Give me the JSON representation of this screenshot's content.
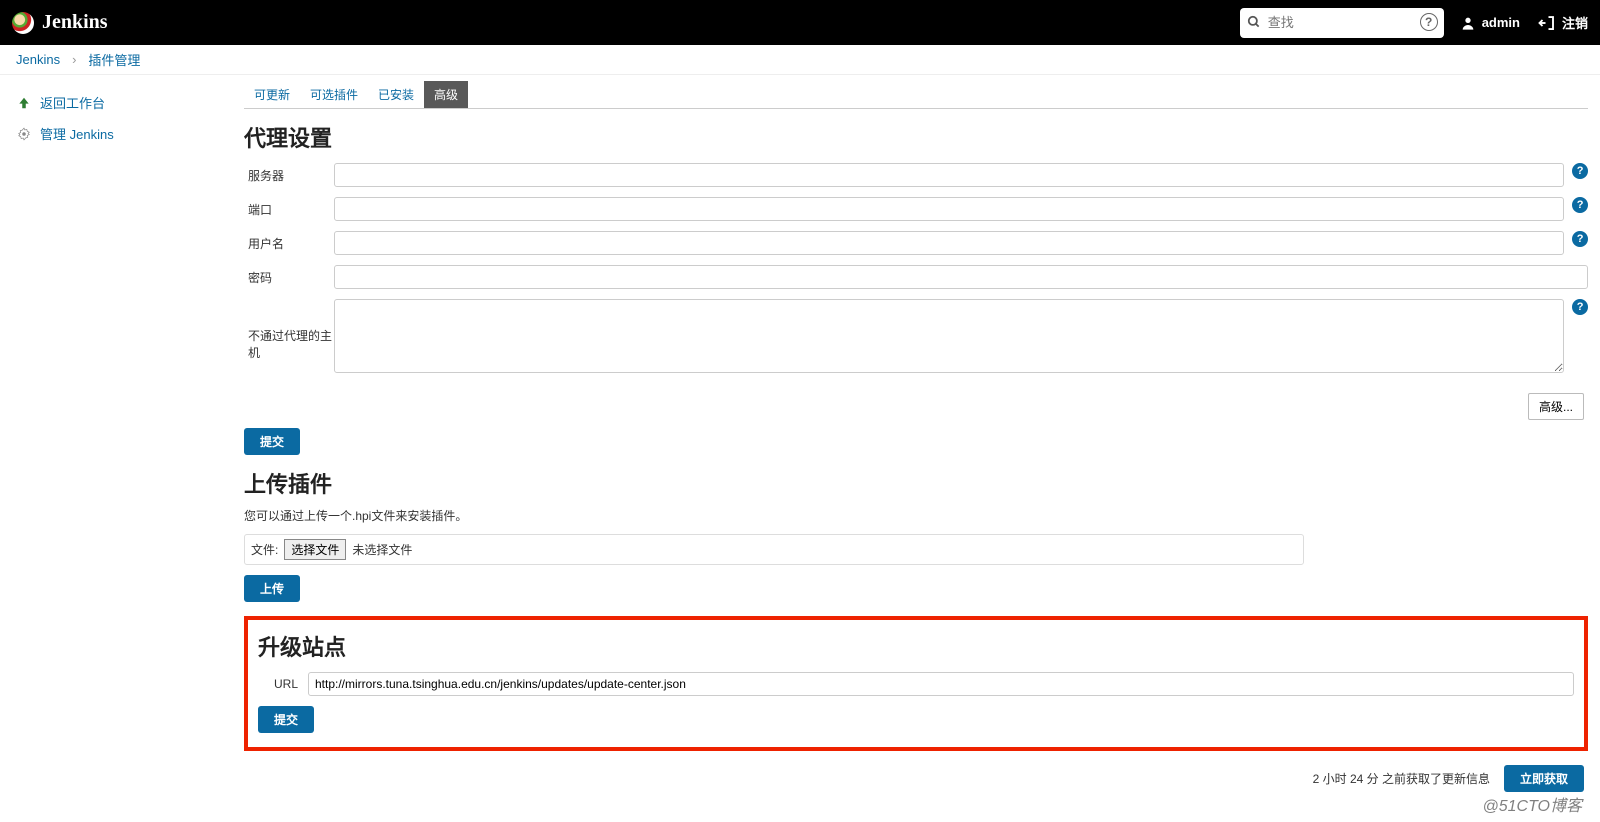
{
  "header": {
    "app_name": "Jenkins",
    "search_placeholder": "查找",
    "user_label": "admin",
    "logout_label": "注销"
  },
  "breadcrumb": {
    "root": "Jenkins",
    "page": "插件管理"
  },
  "sidebar": {
    "items": [
      {
        "label": "返回工作台"
      },
      {
        "label": "管理 Jenkins"
      }
    ]
  },
  "tabs": {
    "items": [
      {
        "label": "可更新"
      },
      {
        "label": "可选插件"
      },
      {
        "label": "已安装"
      },
      {
        "label": "高级",
        "active": true
      }
    ]
  },
  "proxy": {
    "title": "代理设置",
    "server_label": "服务器",
    "server_value": "",
    "port_label": "端口",
    "port_value": "",
    "user_label": "用户名",
    "user_value": "",
    "password_label": "密码",
    "password_value": "",
    "noproxy_label": "不通过代理的主机",
    "noproxy_value": "",
    "advanced_button": "高级...",
    "submit": "提交"
  },
  "upload": {
    "title": "上传插件",
    "desc": "您可以通过上传一个.hpi文件来安装插件。",
    "file_label": "文件:",
    "choose_btn": "选择文件",
    "no_file": "未选择文件",
    "submit": "上传"
  },
  "update_site": {
    "title": "升级站点",
    "url_label": "URL",
    "url_value": "http://mirrors.tuna.tsinghua.edu.cn/jenkins/updates/update-center.json",
    "submit": "提交"
  },
  "footer": {
    "status": "2 小时 24 分 之前获取了更新信息",
    "check_now": "立即获取"
  },
  "watermark": "@51CTO博客"
}
